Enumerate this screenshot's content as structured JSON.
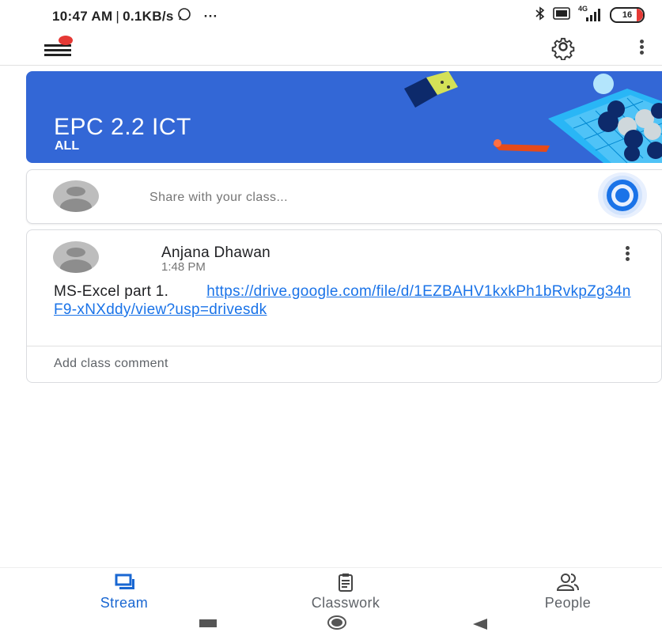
{
  "status_bar": {
    "time": "10:47 AM",
    "separator": "|",
    "data_speed": "0.1KB/s",
    "more": "···",
    "network": "4G",
    "battery": "16"
  },
  "app_bar": {
    "menu_icon": "hamburger-menu-icon",
    "settings_icon": "gear-icon",
    "more_icon": "more-vert-icon"
  },
  "banner": {
    "title": "EPC 2.2 ICT",
    "section": "ALL",
    "color": "#3367d6"
  },
  "share": {
    "placeholder": "Share with your class..."
  },
  "post": {
    "author": "Anjana Dhawan",
    "time": "1:48 PM",
    "text": "MS-Excel part 1.",
    "link": "https://drive.google.com/file/d/1EZBAHV1kxkPh1bRvkpZg34nF9-xNXddy/view?usp=drivesdk",
    "comment_placeholder": "Add class comment"
  },
  "bottom_nav": {
    "items": [
      {
        "label": "Stream",
        "icon": "stream-icon",
        "active": true
      },
      {
        "label": "Classwork",
        "icon": "clipboard-icon",
        "active": false
      },
      {
        "label": "People",
        "icon": "people-icon",
        "active": false
      }
    ],
    "active_color": "#1967d2"
  },
  "system_nav": {
    "recents_icon": "square-icon",
    "home_icon": "circle-icon",
    "back_icon": "triangle-back-icon"
  }
}
